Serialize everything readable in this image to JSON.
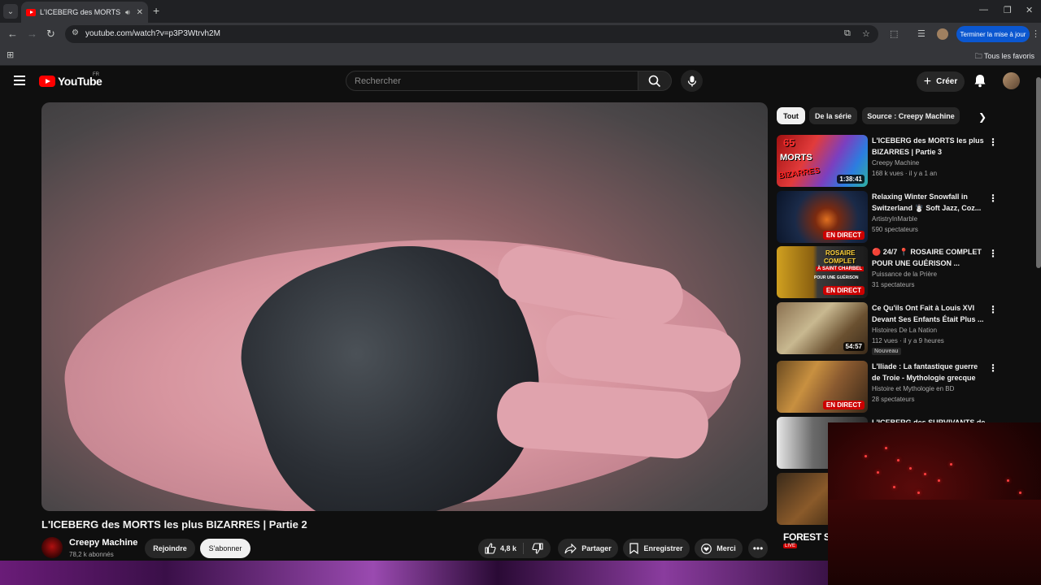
{
  "browser": {
    "tab_title": "L'ICEBERG des MORTS les plus BIZARRES | Partie 2",
    "url": "youtube.com/watch?v=p3P3Wtrvh2M",
    "update_label": "Terminer la mise à jour",
    "all_bookmarks": "Tous les favoris"
  },
  "youtube": {
    "logo_text": "YouTube",
    "region": "FR",
    "search_placeholder": "Rechercher",
    "create_label": "Créer"
  },
  "video": {
    "title": "L'ICEBERG des MORTS les plus BIZARRES | Partie 2",
    "channel": "Creepy Machine",
    "subscribers": "78,2 k abonnés",
    "join_label": "Rejoindre",
    "subscribe_label": "S'abonner",
    "likes": "4,8 k",
    "share_label": "Partager",
    "save_label": "Enregistrer",
    "thanks_label": "Merci"
  },
  "chips": [
    "Tout",
    "De la série",
    "Source : Creepy Machine"
  ],
  "recommendations": [
    {
      "title": "L'ICEBERG des MORTS les plus BIZARRES | Partie 3",
      "channel": "Creepy Machine",
      "meta": "168 k vues · il y a 1 an",
      "badge": "1:38:41"
    },
    {
      "title": "Relaxing Winter Snowfall in Switzerland ☃️ Soft Jazz, Coz...",
      "channel": "ArtistryInMarble",
      "meta": "590 spectateurs",
      "badge": "EN DIRECT"
    },
    {
      "title": "🔴 24/7 📍 ROSAIRE COMPLET POUR UNE GUÉRISON ...",
      "channel": "Puissance de la Prière",
      "meta": "31 spectateurs",
      "badge": "EN DIRECT"
    },
    {
      "title": "Ce Qu'ils Ont Fait à Louis XVI Devant Ses Enfants Était Plus ...",
      "channel": "Histoires De La Nation",
      "meta": "112 vues · il y a 9 heures",
      "badge": "54:57",
      "new": "Nouveau"
    },
    {
      "title": "L'Iliade : La fantastique guerre de Troie - Mythologie grecque",
      "channel": "Histoire et Mythologie en BD",
      "meta": "28 spectateurs",
      "badge": "EN DIRECT"
    },
    {
      "title": "L'ICEBERG des SURVIVANTS de",
      "channel": "",
      "meta": "",
      "badge": ""
    }
  ],
  "thumb_texts": {
    "rec1_line1": "65",
    "rec1_line2": "MORTS",
    "rec1_line3": "BIZARRES",
    "rec3_line1": "ROSAIRE",
    "rec3_line2": "COMPLET",
    "rec3_line3": "À SAINT CHARBEL",
    "rec3_line4": "POUR UNE GUÉRISON"
  },
  "mini_player": {
    "label": "FOREST S",
    "live": "LIVE"
  }
}
